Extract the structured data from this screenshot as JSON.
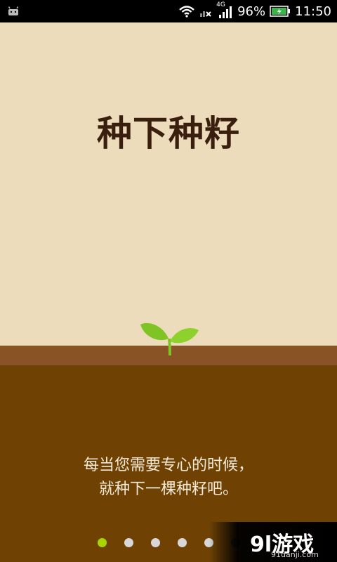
{
  "status_bar": {
    "battery_level": "96%",
    "time": "11:50",
    "network_label": "4G"
  },
  "onboarding": {
    "title": "种下种籽",
    "description_lines": [
      "每当您需要专心的时候，",
      "就种下一棵种籽吧。"
    ]
  },
  "pager": {
    "page_count": 6,
    "current_page": 1
  },
  "watermark": {
    "brand": "9l游戏",
    "domain": "91danji.com"
  },
  "colors": {
    "sky": "#eddcbc",
    "topsoil": "#8a5325",
    "soil": "#6f4204",
    "title_text": "#3a1f0f",
    "active_dot": "#a6d500"
  }
}
